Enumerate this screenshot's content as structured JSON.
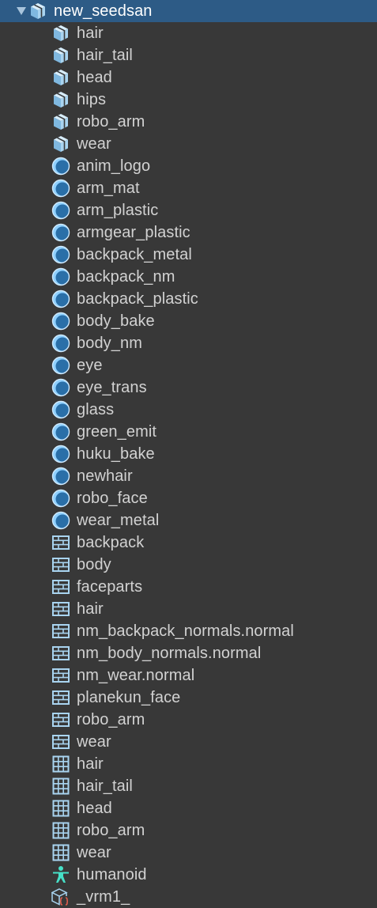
{
  "root": {
    "label": "new_seedsan",
    "icon": "prefab-icon",
    "expanded": true
  },
  "items": [
    {
      "label": "hair",
      "icon": "prefab-icon"
    },
    {
      "label": "hair_tail",
      "icon": "prefab-icon"
    },
    {
      "label": "head",
      "icon": "prefab-icon"
    },
    {
      "label": "hips",
      "icon": "prefab-icon"
    },
    {
      "label": "robo_arm",
      "icon": "prefab-icon"
    },
    {
      "label": "wear",
      "icon": "prefab-icon"
    },
    {
      "label": "anim_logo",
      "icon": "material-icon"
    },
    {
      "label": "arm_mat",
      "icon": "material-icon"
    },
    {
      "label": "arm_plastic",
      "icon": "material-icon"
    },
    {
      "label": "armgear_plastic",
      "icon": "material-icon"
    },
    {
      "label": "backpack_metal",
      "icon": "material-icon"
    },
    {
      "label": "backpack_nm",
      "icon": "material-icon"
    },
    {
      "label": "backpack_plastic",
      "icon": "material-icon"
    },
    {
      "label": "body_bake",
      "icon": "material-icon"
    },
    {
      "label": "body_nm",
      "icon": "material-icon"
    },
    {
      "label": "eye",
      "icon": "material-icon"
    },
    {
      "label": "eye_trans",
      "icon": "material-icon"
    },
    {
      "label": "glass",
      "icon": "material-icon"
    },
    {
      "label": "green_emit",
      "icon": "material-icon"
    },
    {
      "label": "huku_bake",
      "icon": "material-icon"
    },
    {
      "label": "newhair",
      "icon": "material-icon"
    },
    {
      "label": "robo_face",
      "icon": "material-icon"
    },
    {
      "label": "wear_metal",
      "icon": "material-icon"
    },
    {
      "label": "backpack",
      "icon": "texture-icon"
    },
    {
      "label": "body",
      "icon": "texture-icon"
    },
    {
      "label": "faceparts",
      "icon": "texture-icon"
    },
    {
      "label": "hair",
      "icon": "texture-icon"
    },
    {
      "label": "nm_backpack_normals.normal",
      "icon": "texture-icon"
    },
    {
      "label": "nm_body_normals.normal",
      "icon": "texture-icon"
    },
    {
      "label": "nm_wear.normal",
      "icon": "texture-icon"
    },
    {
      "label": "planekun_face",
      "icon": "texture-icon"
    },
    {
      "label": "robo_arm",
      "icon": "texture-icon"
    },
    {
      "label": "wear",
      "icon": "texture-icon"
    },
    {
      "label": "hair",
      "icon": "mesh-icon"
    },
    {
      "label": "hair_tail",
      "icon": "mesh-icon"
    },
    {
      "label": "head",
      "icon": "mesh-icon"
    },
    {
      "label": "robo_arm",
      "icon": "mesh-icon"
    },
    {
      "label": "wear",
      "icon": "mesh-icon"
    },
    {
      "label": "humanoid",
      "icon": "avatar-icon"
    },
    {
      "label": "_vrm1_",
      "icon": "script-object-icon"
    }
  ],
  "colors": {
    "selected_bg": "#2d5b86",
    "panel_bg": "#383838",
    "text": "#d2d2d2",
    "icon_blue": "#8fd0ff",
    "avatar_cyan": "#46e0c8",
    "script_red": "#e25c4c"
  }
}
